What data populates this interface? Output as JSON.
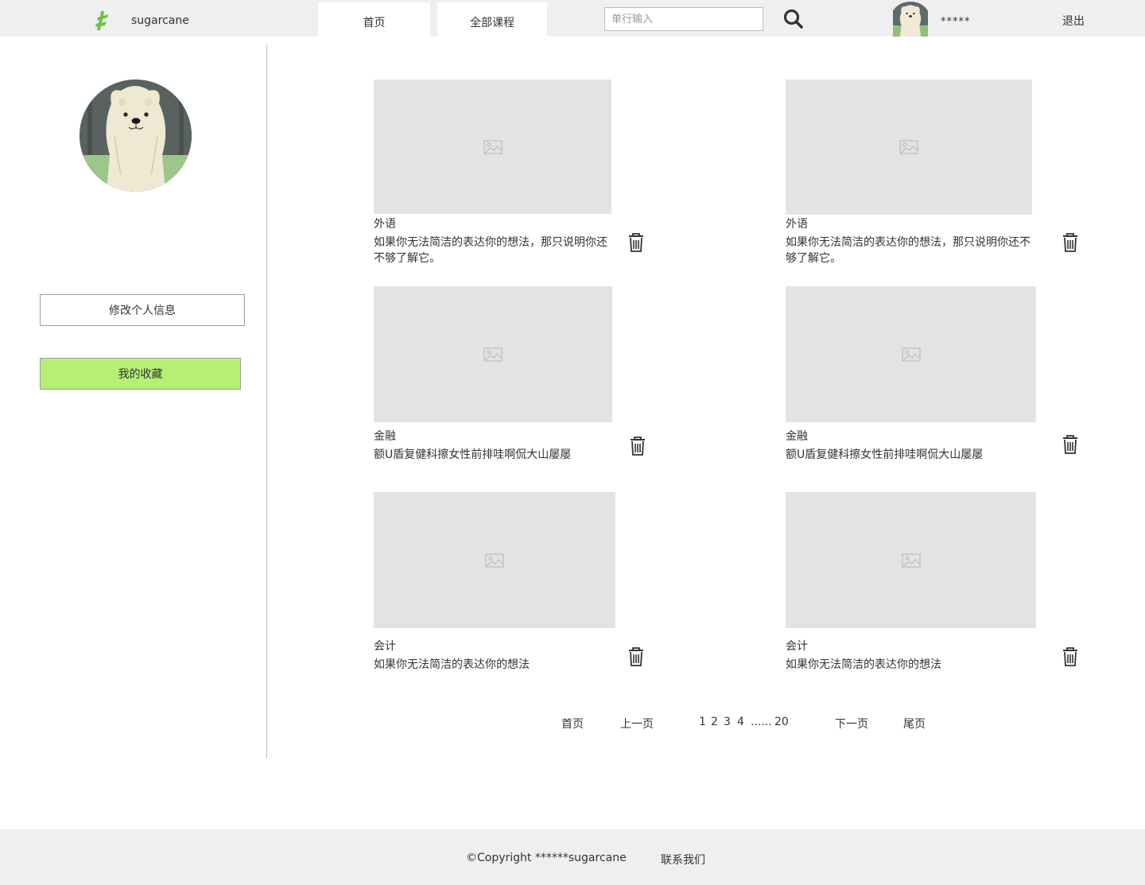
{
  "header": {
    "brand": "sugarcane",
    "tabs": [
      {
        "label": "首页"
      },
      {
        "label": "全部课程"
      }
    ],
    "search_placeholder": "单行输入",
    "username": "*****",
    "logout": "退出"
  },
  "sidebar": {
    "edit_profile": "修改个人信息",
    "favorites": "我的收藏"
  },
  "cards": [
    {
      "category": "外语",
      "desc": "如果你无法简洁的表达你的想法，那只说明你还不够了解它。"
    },
    {
      "category": "外语",
      "desc": "如果你无法简洁的表达你的想法，那只说明你还不够了解它。"
    },
    {
      "category": "金融",
      "desc": "额U盾复健科擦女性前排哇啊侃大山屡屡"
    },
    {
      "category": "金融",
      "desc": "额U盾复健科擦女性前排哇啊侃大山屡屡"
    },
    {
      "category": "会计",
      "desc": "如果你无法简洁的表达你的想法"
    },
    {
      "category": "会计",
      "desc": "如果你无法简洁的表达你的想法"
    }
  ],
  "pagination": {
    "first": "首页",
    "prev": "上一页",
    "pages": [
      "1",
      "2",
      "3",
      "4"
    ],
    "ellipsis": "......",
    "last_page": "20",
    "next": "下一页",
    "end": "尾页"
  },
  "footer": {
    "copyright": "©Copyright ******sugarcane",
    "contact": "联系我们"
  },
  "colors": {
    "topbar_bg": "#efefef",
    "favorites_active": "#b5ef74",
    "logo_green": "#6cc04a",
    "placeholder_bg": "#e3e3e3"
  },
  "icons": [
    "logo-icon",
    "search-icon",
    "avatar",
    "image-placeholder-icon",
    "trash-icon"
  ]
}
